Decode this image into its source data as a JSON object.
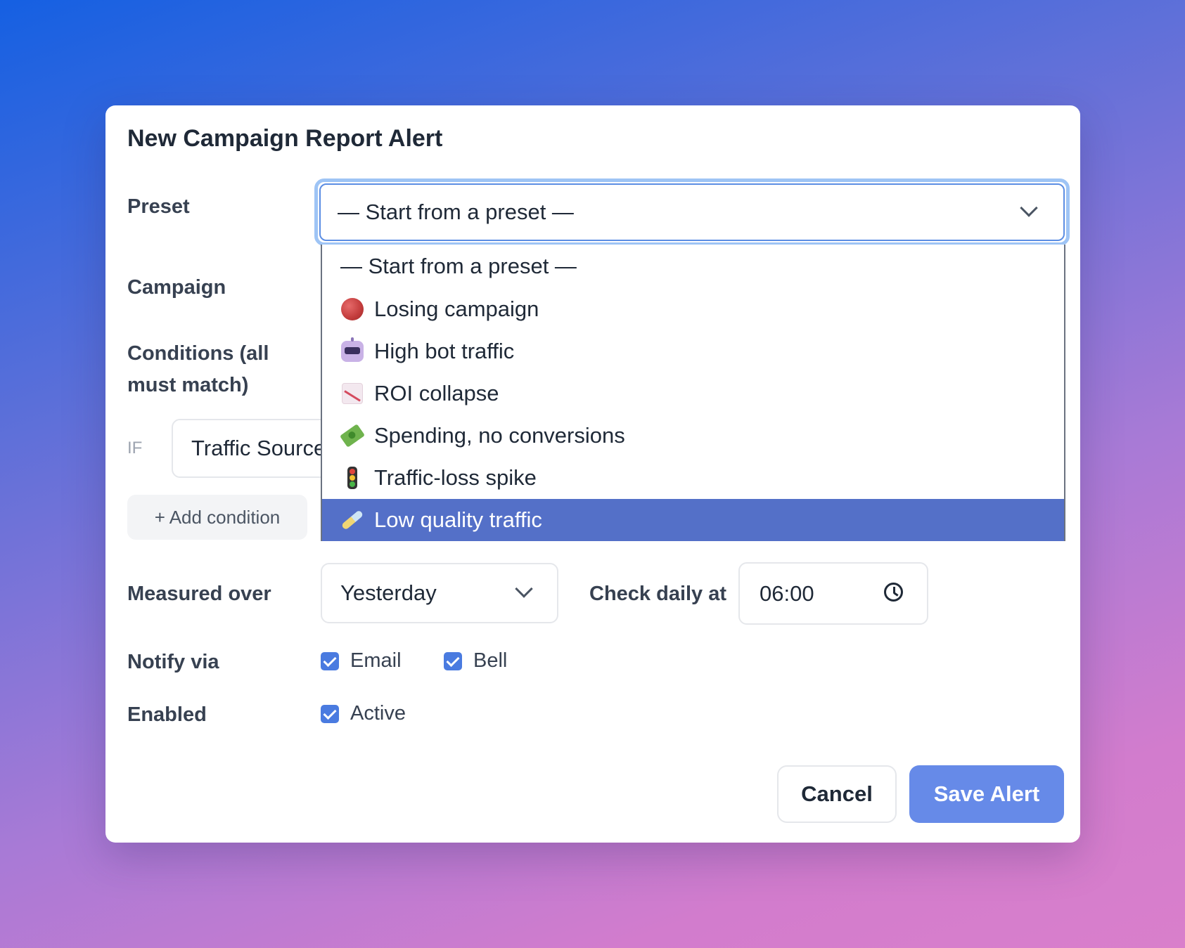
{
  "dialog": {
    "title": "New Campaign Report Alert"
  },
  "preset": {
    "label": "Preset",
    "selected": "— Start from a preset —",
    "options": [
      {
        "label": "— Start from a preset —",
        "icon": ""
      },
      {
        "label": "Losing campaign",
        "icon": "red-circle-icon"
      },
      {
        "label": "High bot traffic",
        "icon": "robot-icon"
      },
      {
        "label": "ROI collapse",
        "icon": "chart-decreasing-icon"
      },
      {
        "label": "Spending, no conversions",
        "icon": "money-with-wings-icon"
      },
      {
        "label": "Traffic-loss spike",
        "icon": "traffic-light-icon"
      },
      {
        "label": "Low quality traffic",
        "icon": "test-tube-icon"
      }
    ],
    "highlighted_index": 6
  },
  "campaign": {
    "label": "Campaign"
  },
  "conditions": {
    "label_line1": "Conditions (all",
    "label_line2": "must match)",
    "if_label": "IF",
    "field_value": "Traffic Source",
    "add_button": "+ Add condition"
  },
  "measured_over": {
    "label": "Measured over",
    "value": "Yesterday"
  },
  "check_daily": {
    "label": "Check daily at",
    "value": "06:00"
  },
  "notify": {
    "label": "Notify via",
    "email_label": "Email",
    "email_checked": true,
    "bell_label": "Bell",
    "bell_checked": true
  },
  "enabled": {
    "label": "Enabled",
    "active_label": "Active",
    "active_checked": true
  },
  "actions": {
    "cancel": "Cancel",
    "save": "Save Alert"
  },
  "colors": {
    "accent": "#4a7be0",
    "save_button": "#668ae8",
    "dropdown_highlight": "#5470c8",
    "focus_ring": "#9ec4f5"
  }
}
